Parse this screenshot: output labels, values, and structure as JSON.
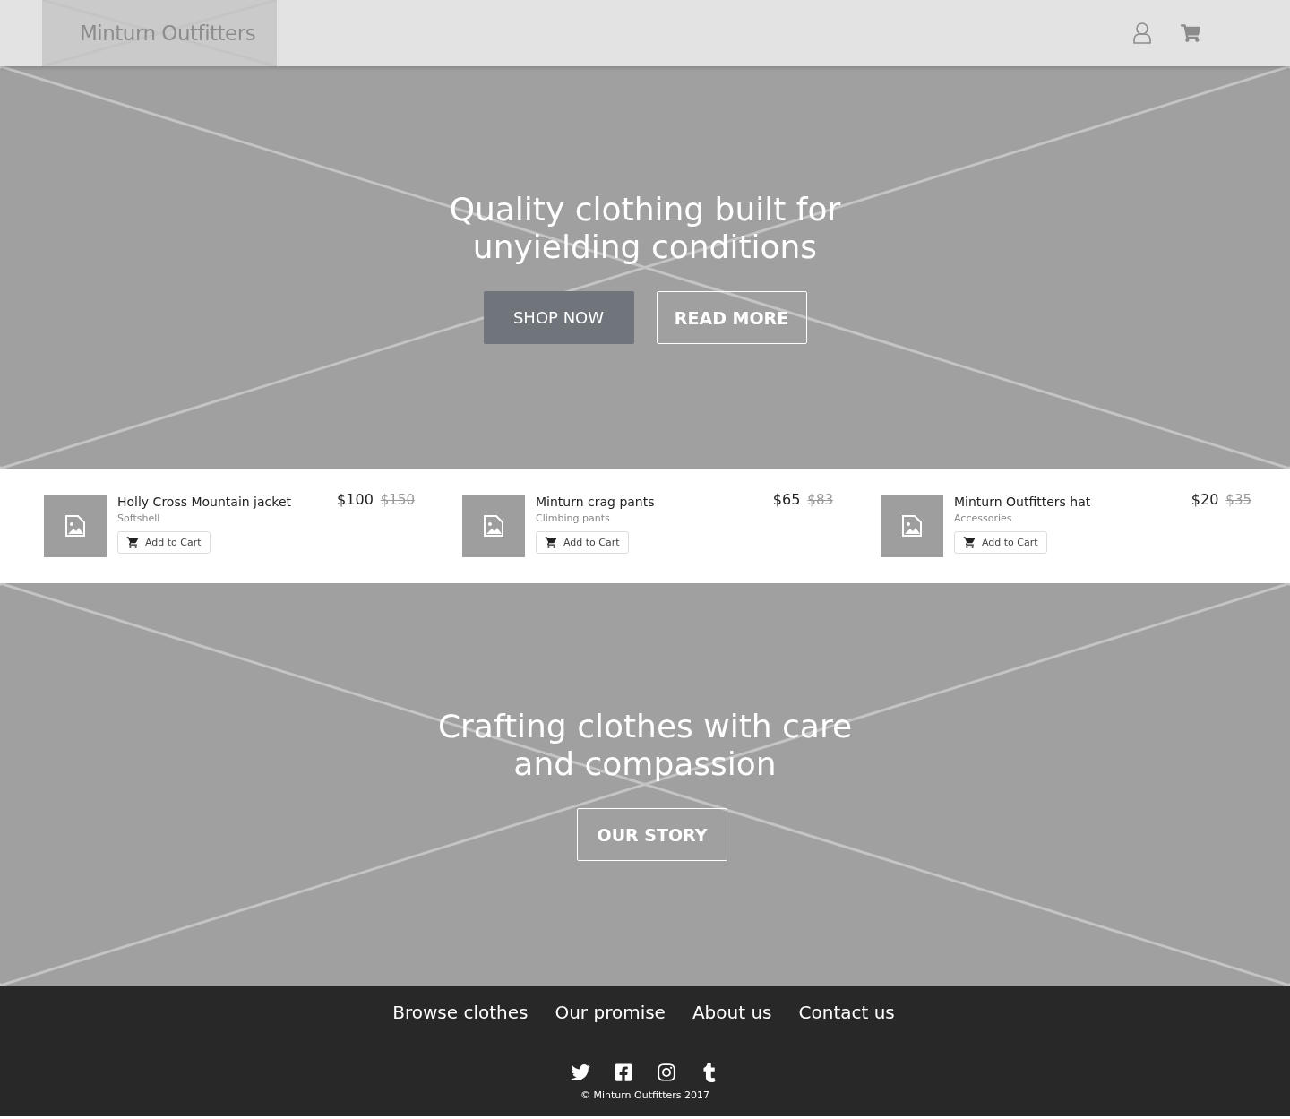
{
  "header": {
    "logo": "Minturn Outfitters"
  },
  "hero": {
    "heading": "Quality clothing built for\nunyielding conditions",
    "buttons": [
      {
        "label": "SHOP NOW",
        "kind": "filled"
      },
      {
        "label": "READ MORE",
        "kind": "outline"
      }
    ]
  },
  "products": [
    {
      "name": "Holly Cross Mountain jacket",
      "category": "Softshell",
      "price": "$100",
      "old_price": "$150",
      "button": "Add to Cart"
    },
    {
      "name": "Minturn crag pants",
      "category": "Climbing pants",
      "price": "$65",
      "old_price": "$83",
      "button": "Add to Cart"
    },
    {
      "name": "Minturn Outfitters hat",
      "category": "Accessories",
      "price": "$20",
      "old_price": "$35",
      "button": "Add to Cart"
    }
  ],
  "story": {
    "heading": "Crafting clothes with care\nand compassion",
    "button": "OUR STORY"
  },
  "footer": {
    "links": [
      "Browse clothes",
      "Our promise",
      "About us",
      "Contact us"
    ],
    "social": [
      {
        "kind": "twitter"
      },
      {
        "kind": "facebook"
      },
      {
        "kind": "instagram"
      },
      {
        "kind": "tumblr"
      }
    ],
    "copyright": "© Minturn Outfitters 2017"
  }
}
